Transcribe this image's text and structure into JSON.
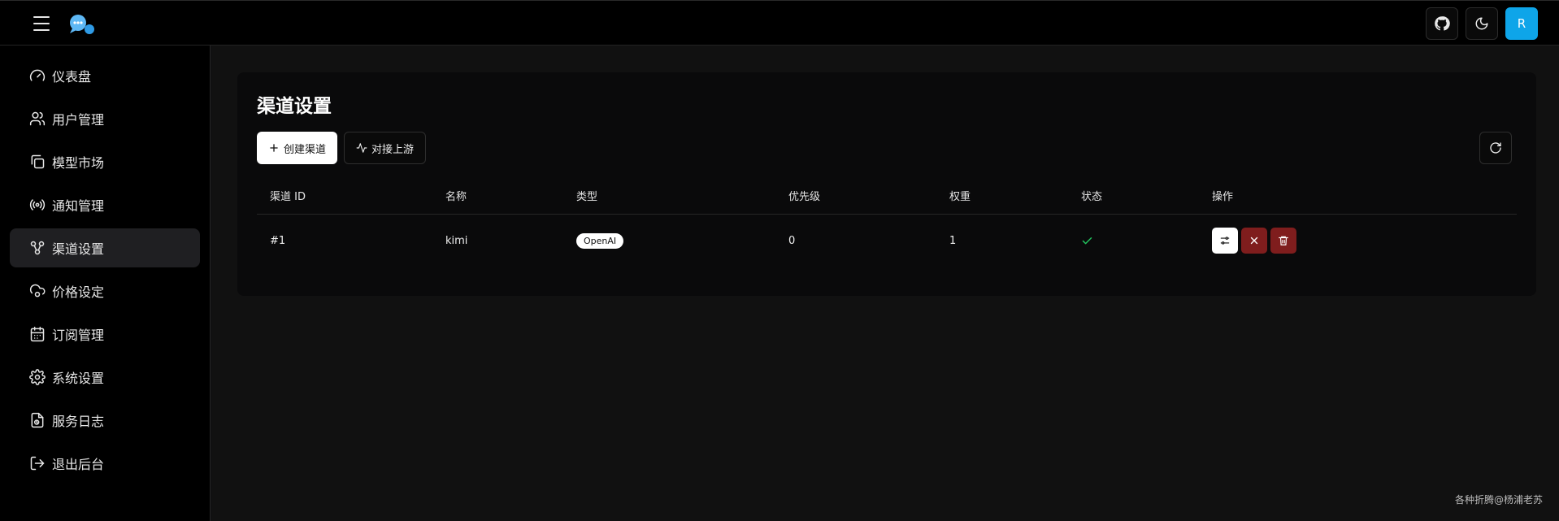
{
  "sidebar": {
    "items": [
      {
        "label": "仪表盘",
        "icon": "gauge-icon"
      },
      {
        "label": "用户管理",
        "icon": "users-icon"
      },
      {
        "label": "模型市场",
        "icon": "copy-icon"
      },
      {
        "label": "通知管理",
        "icon": "radio-icon"
      },
      {
        "label": "渠道设置",
        "icon": "channel-icon",
        "active": true
      },
      {
        "label": "价格设定",
        "icon": "cloud-cog-icon"
      },
      {
        "label": "订阅管理",
        "icon": "calendar-icon"
      },
      {
        "label": "系统设置",
        "icon": "gear-icon"
      },
      {
        "label": "服务日志",
        "icon": "file-log-icon"
      },
      {
        "label": "退出后台",
        "icon": "logout-icon"
      }
    ]
  },
  "header": {
    "avatar_initial": "R",
    "accent_color": "#0ea5e9"
  },
  "page": {
    "title": "渠道设置",
    "create_button": "创建渠道",
    "upstream_button": "对接上游"
  },
  "table": {
    "columns": [
      "渠道 ID",
      "名称",
      "类型",
      "优先级",
      "权重",
      "状态",
      "操作"
    ],
    "rows": [
      {
        "id": "#1",
        "name": "kimi",
        "type": "OpenAI",
        "priority": "0",
        "weight": "1",
        "status": "enabled"
      }
    ]
  },
  "footer": {
    "text": "各种折腾@杨浦老苏"
  },
  "colors": {
    "status_ok": "#22c55e",
    "danger": "#7f1d1d"
  }
}
